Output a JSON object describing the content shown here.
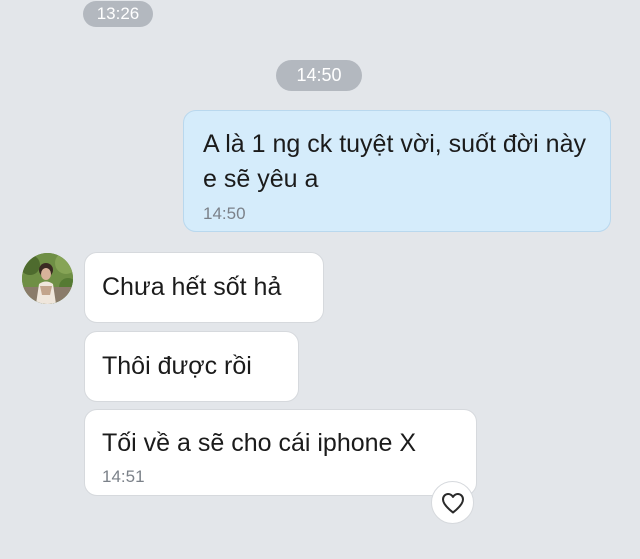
{
  "chat": {
    "time_divider_1": "13:26",
    "time_divider_2": "14:50",
    "messages": [
      {
        "direction": "outgoing",
        "text": "A là 1 ng ck tuyệt vời, suốt đời này e sẽ yêu a",
        "time": "14:50"
      },
      {
        "direction": "incoming",
        "text": "Chưa hết sốt hả"
      },
      {
        "direction": "incoming",
        "text": "Thôi được rồi"
      },
      {
        "direction": "incoming",
        "text": "Tối về a sẽ cho cái iphone X",
        "time": "14:51"
      }
    ]
  },
  "contact": {
    "avatar_icon": "user-avatar-photo"
  },
  "actions": {
    "reaction_icon": "heart-icon"
  },
  "colors": {
    "background": "#e3e6ea",
    "outgoing_bubble": "#d5ecfb",
    "incoming_bubble": "#ffffff",
    "time_pill": "#b3b8bf",
    "timestamp_text": "#7b8189"
  }
}
